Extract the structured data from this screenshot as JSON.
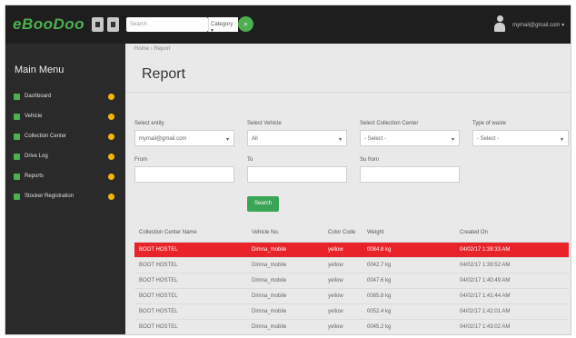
{
  "colors": {
    "accent": "#4caf50",
    "highlight_row": "#e8232a",
    "badge": "#f5b400",
    "topbar": "#1e1e1e",
    "sidebar": "#2a2a2a"
  },
  "header": {
    "logo_text": "eBooDoo",
    "search_placeholder": "Search",
    "category_label": "Category ▾",
    "user_email": "mymail@gmail.com ▾"
  },
  "sidebar": {
    "title": "Main Menu",
    "items": [
      {
        "label": "Dashboard",
        "icon": "home-icon"
      },
      {
        "label": "Vehicle",
        "icon": "car-icon"
      },
      {
        "label": "Collection Center",
        "icon": "pin-icon"
      },
      {
        "label": "Drive Log",
        "icon": "list-icon"
      },
      {
        "label": "Reports",
        "icon": "chart-icon"
      },
      {
        "label": "Stocker Registration",
        "icon": "register-icon"
      }
    ]
  },
  "breadcrumb": "Home › Report",
  "page_title": "Report",
  "filters": {
    "select_entity_label": "Select entity",
    "select_entity_value": "mymail@gmail.com",
    "select_vehicle_label": "Select Vehicle",
    "select_vehicle_value": "All",
    "select_collection_label": "Select Collection Center",
    "select_collection_value": "- Select -",
    "type_of_waste_label": "Type of waste",
    "type_of_waste_value": "- Select -",
    "from_label": "From",
    "to_label": "To",
    "su_from_label": "Su from",
    "search_button": "Search"
  },
  "table": {
    "headers": [
      "Collection Center Name",
      "Vehicle No.",
      "Color Code",
      "Weight",
      "Created On"
    ],
    "rows": [
      [
        "BOOT HOSTEL",
        "Dimna_mobile",
        "yellow",
        "0084.8 kg",
        "04/02/17 1:38:33 AM"
      ],
      [
        "BOOT HOSTEL",
        "Dimna_mobile",
        "yellow",
        "0042.7 kg",
        "04/02/17 1:39:52 AM"
      ],
      [
        "BOOT HOSTEL",
        "Dimna_mobile",
        "yellow",
        "0047.6 kg",
        "04/02/17 1:40:49 AM"
      ],
      [
        "BOOT HOSTEL",
        "Dimna_mobile",
        "yellow",
        "0085.8 kg",
        "04/02/17 1:41:44 AM"
      ],
      [
        "BOOT HOSTEL",
        "Dimna_mobile",
        "yellow",
        "0052.4 kg",
        "04/02/17 1:42:01 AM"
      ],
      [
        "BOOT HOSTEL",
        "Dimna_mobile",
        "yellow",
        "0045.2 kg",
        "04/02/17 1:43:02 AM"
      ]
    ]
  }
}
